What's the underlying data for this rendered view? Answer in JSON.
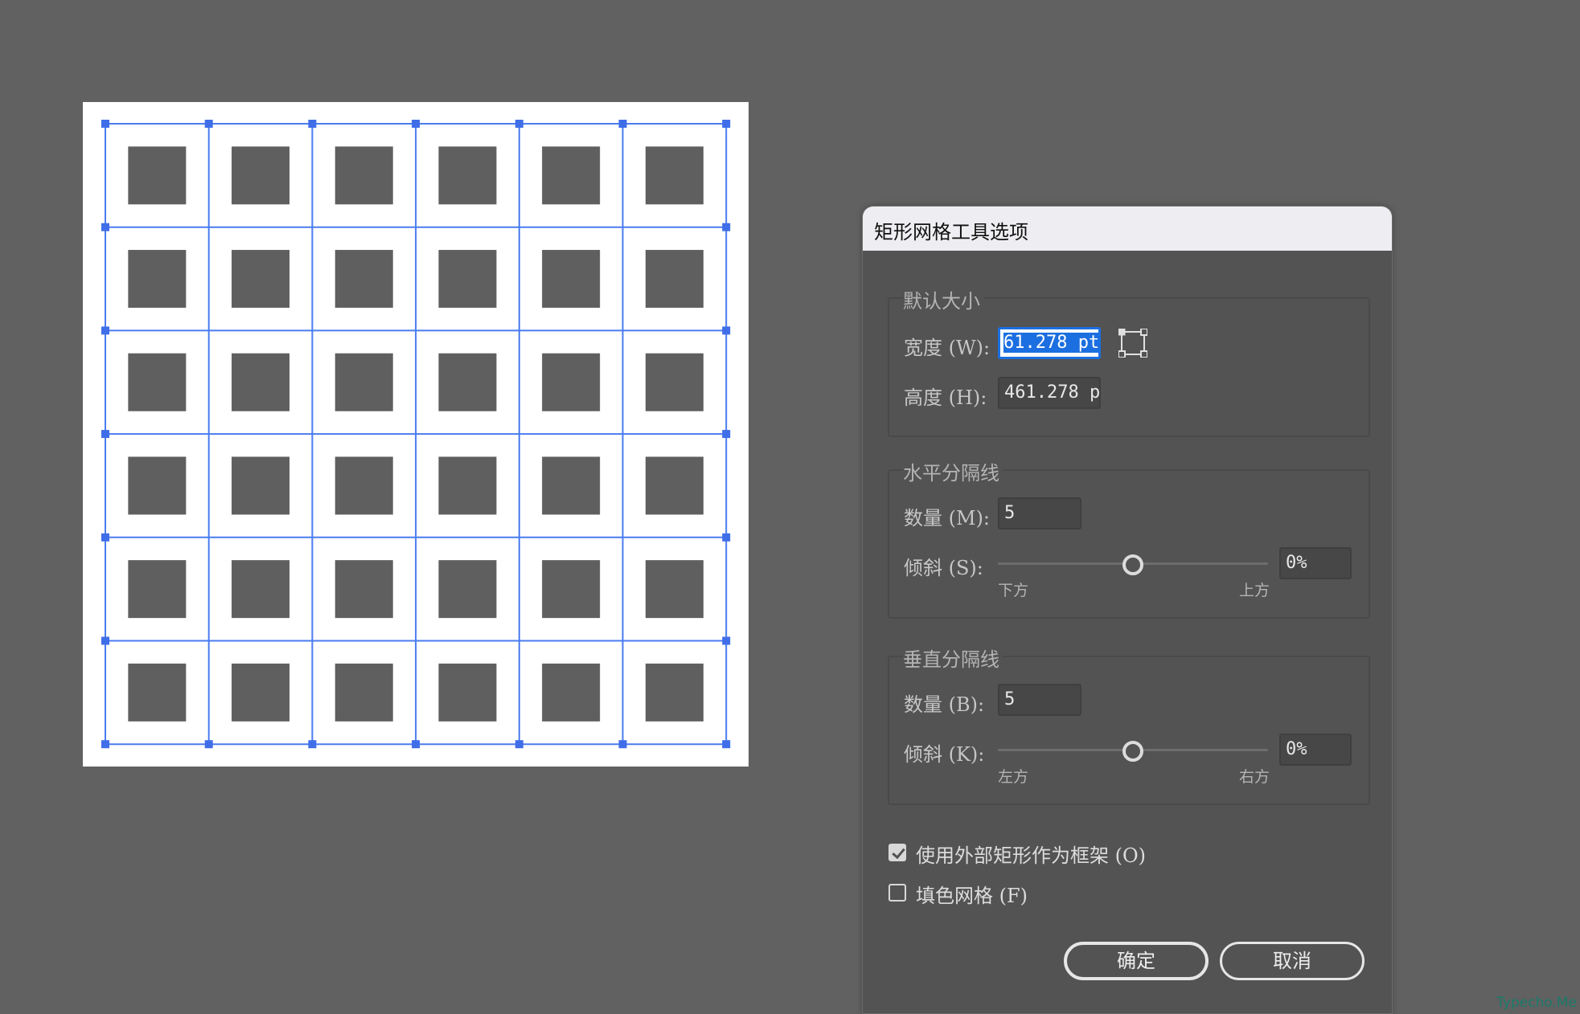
{
  "canvas": {
    "grid": {
      "rows": 6,
      "cols": 6,
      "cell_color": "#5f5f5f",
      "line_color": "#4a7cf0",
      "handle_color": "#3f6ee8"
    }
  },
  "dialog": {
    "title": "矩形网格工具选项",
    "default_size": {
      "group_title": "默认大小",
      "width_label": "宽度 (W):",
      "width_value": "61.278 pt",
      "height_label": "高度 (H):",
      "height_value": "461.278 p",
      "origin_icon": "reference-point-icon"
    },
    "horizontal_dividers": {
      "group_title": "水平分隔线",
      "count_label": "数量 (M):",
      "count_value": "5",
      "skew_label": "倾斜 (S):",
      "skew_value": "0%",
      "skew_position": 0.5,
      "min_caption": "下方",
      "max_caption": "上方"
    },
    "vertical_dividers": {
      "group_title": "垂直分隔线",
      "count_label": "数量 (B):",
      "count_value": "5",
      "skew_label": "倾斜 (K):",
      "skew_value": "0%",
      "skew_position": 0.5,
      "min_caption": "左方",
      "max_caption": "右方"
    },
    "options": {
      "use_outer_rect": {
        "label": "使用外部矩形作为框架 (O)",
        "checked": true
      },
      "fill_grid": {
        "label": "填色网格 (F)",
        "checked": false
      }
    },
    "buttons": {
      "ok": "确定",
      "cancel": "取消"
    }
  },
  "watermark": "Typecho.Me"
}
